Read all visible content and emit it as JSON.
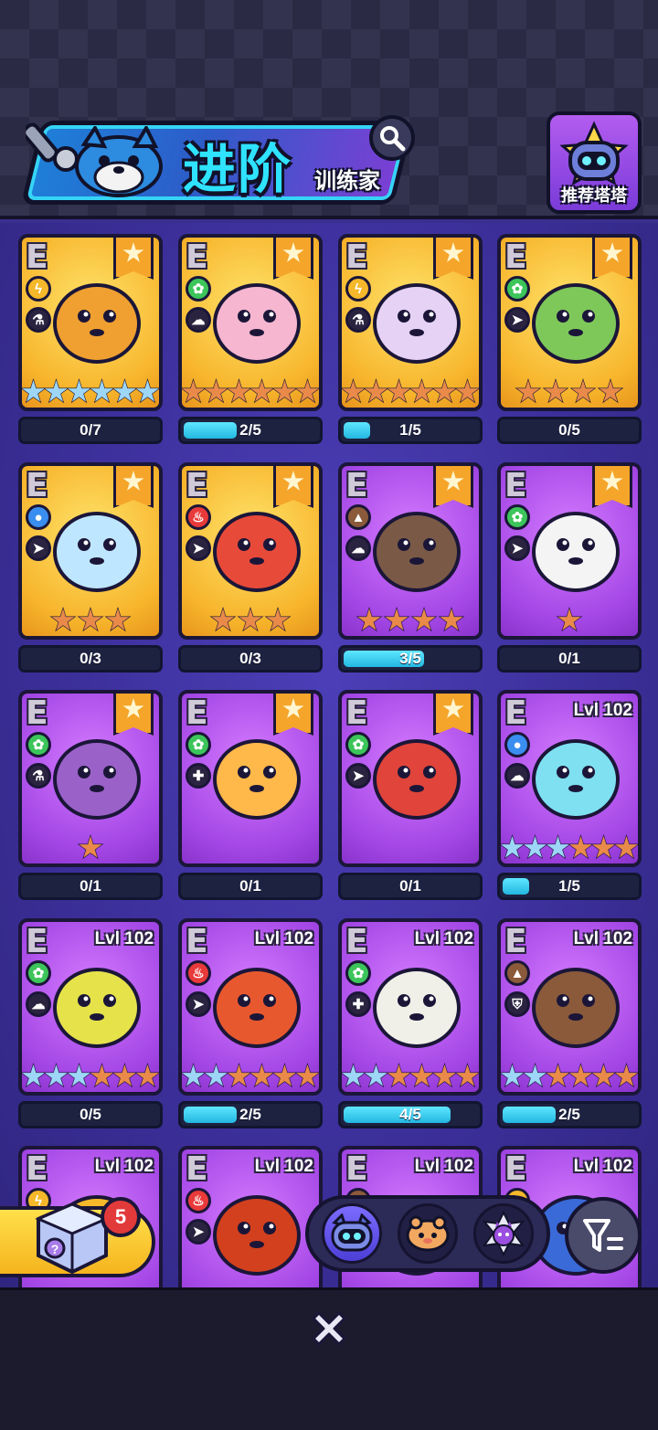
{
  "header": {
    "title": "进阶",
    "subtitle": "训练家",
    "recommend_label": "推荐塔塔"
  },
  "icons": {
    "search": "search-icon",
    "recommend": "robot-cat-icon",
    "close": "close-icon",
    "filter": "filter-icon",
    "gift": "mystery-box-icon"
  },
  "colors": {
    "gold_card": "#f7b52c",
    "purple_card": "#a447e6",
    "progress_fill": "#23b7e0",
    "bg": "#3a2f8f"
  },
  "cards": [
    {
      "grade": "E",
      "lvl": "",
      "progress": "0/7",
      "fill": 0,
      "el": "electric",
      "role": "flask",
      "stars_blue": 6,
      "stars_bronze": 0,
      "bg": "gold",
      "ribbon": true
    },
    {
      "grade": "E",
      "lvl": "",
      "progress": "2/5",
      "fill": 0.4,
      "el": "grass",
      "role": "ghost",
      "stars_blue": 0,
      "stars_bronze": 6,
      "bg": "gold",
      "ribbon": true
    },
    {
      "grade": "E",
      "lvl": "",
      "progress": "1/5",
      "fill": 0.2,
      "el": "electric",
      "role": "flask",
      "stars_blue": 0,
      "stars_bronze": 6,
      "bg": "gold",
      "ribbon": true
    },
    {
      "grade": "E",
      "lvl": "",
      "progress": "0/5",
      "fill": 0,
      "el": "grass",
      "role": "run",
      "stars_blue": 0,
      "stars_bronze": 4,
      "bg": "gold",
      "ribbon": true
    },
    {
      "grade": "E",
      "lvl": "",
      "progress": "0/3",
      "fill": 0,
      "el": "water",
      "role": "run",
      "stars_blue": 0,
      "stars_bronze": 3,
      "bg": "gold",
      "ribbon": true
    },
    {
      "grade": "E",
      "lvl": "",
      "progress": "0/3",
      "fill": 0,
      "el": "fire",
      "role": "run",
      "stars_blue": 0,
      "stars_bronze": 3,
      "bg": "gold",
      "ribbon": true
    },
    {
      "grade": "E",
      "lvl": "",
      "progress": "3/5",
      "fill": 0.6,
      "el": "earth",
      "role": "ghost",
      "stars_blue": 0,
      "stars_bronze": 4,
      "bg": "purple",
      "ribbon": true
    },
    {
      "grade": "E",
      "lvl": "",
      "progress": "0/1",
      "fill": 0,
      "el": "grass",
      "role": "run",
      "stars_blue": 0,
      "stars_bronze": 1,
      "bg": "purple",
      "ribbon": true
    },
    {
      "grade": "E",
      "lvl": "",
      "progress": "0/1",
      "fill": 0,
      "el": "grass",
      "role": "flask",
      "stars_blue": 0,
      "stars_bronze": 1,
      "bg": "purple",
      "ribbon": true
    },
    {
      "grade": "E",
      "lvl": "",
      "progress": "0/1",
      "fill": 0,
      "el": "grass",
      "role": "heal",
      "stars_blue": 0,
      "stars_bronze": 0,
      "bg": "purple",
      "ribbon": true
    },
    {
      "grade": "E",
      "lvl": "",
      "progress": "0/1",
      "fill": 0,
      "el": "grass",
      "role": "run",
      "stars_blue": 0,
      "stars_bronze": 0,
      "bg": "purple",
      "ribbon": true
    },
    {
      "grade": "E",
      "lvl": "Lvl 102",
      "progress": "1/5",
      "fill": 0.2,
      "el": "water",
      "role": "ghost",
      "stars_blue": 3,
      "stars_bronze": 3,
      "bg": "purple",
      "ribbon": false
    },
    {
      "grade": "E",
      "lvl": "Lvl 102",
      "progress": "0/5",
      "fill": 0,
      "el": "grass",
      "role": "ghost",
      "stars_blue": 3,
      "stars_bronze": 3,
      "bg": "purple",
      "ribbon": false
    },
    {
      "grade": "E",
      "lvl": "Lvl 102",
      "progress": "2/5",
      "fill": 0.4,
      "el": "fire",
      "role": "run",
      "stars_blue": 2,
      "stars_bronze": 4,
      "bg": "purple",
      "ribbon": false
    },
    {
      "grade": "E",
      "lvl": "Lvl 102",
      "progress": "4/5",
      "fill": 0.8,
      "el": "grass",
      "role": "heal",
      "stars_blue": 2,
      "stars_bronze": 4,
      "bg": "purple",
      "ribbon": false
    },
    {
      "grade": "E",
      "lvl": "Lvl 102",
      "progress": "2/5",
      "fill": 0.4,
      "el": "earth",
      "role": "shield",
      "stars_blue": 2,
      "stars_bronze": 4,
      "bg": "purple",
      "ribbon": false
    },
    {
      "grade": "E",
      "lvl": "Lvl 102",
      "progress": "",
      "fill": 0,
      "el": "electric",
      "role": "run",
      "stars_blue": 0,
      "stars_bronze": 0,
      "bg": "purple",
      "ribbon": false
    },
    {
      "grade": "E",
      "lvl": "Lvl 102",
      "progress": "",
      "fill": 0,
      "el": "fire",
      "role": "run",
      "stars_blue": 0,
      "stars_bronze": 0,
      "bg": "purple",
      "ribbon": false
    },
    {
      "grade": "E",
      "lvl": "Lvl 102",
      "progress": "",
      "fill": 0,
      "el": "earth",
      "role": "run",
      "stars_blue": 0,
      "stars_bronze": 0,
      "bg": "purple",
      "ribbon": false
    },
    {
      "grade": "E",
      "lvl": "Lvl 102",
      "progress": "",
      "fill": 0,
      "el": "electric",
      "role": "run",
      "stars_blue": 0,
      "stars_bronze": 0,
      "bg": "purple",
      "ribbon": false
    }
  ],
  "gift": {
    "count": "5"
  },
  "tabs": [
    {
      "name": "tab-robot-cat",
      "active": true
    },
    {
      "name": "tab-bread-creature",
      "active": false
    },
    {
      "name": "tab-purple-cat",
      "active": false
    }
  ]
}
